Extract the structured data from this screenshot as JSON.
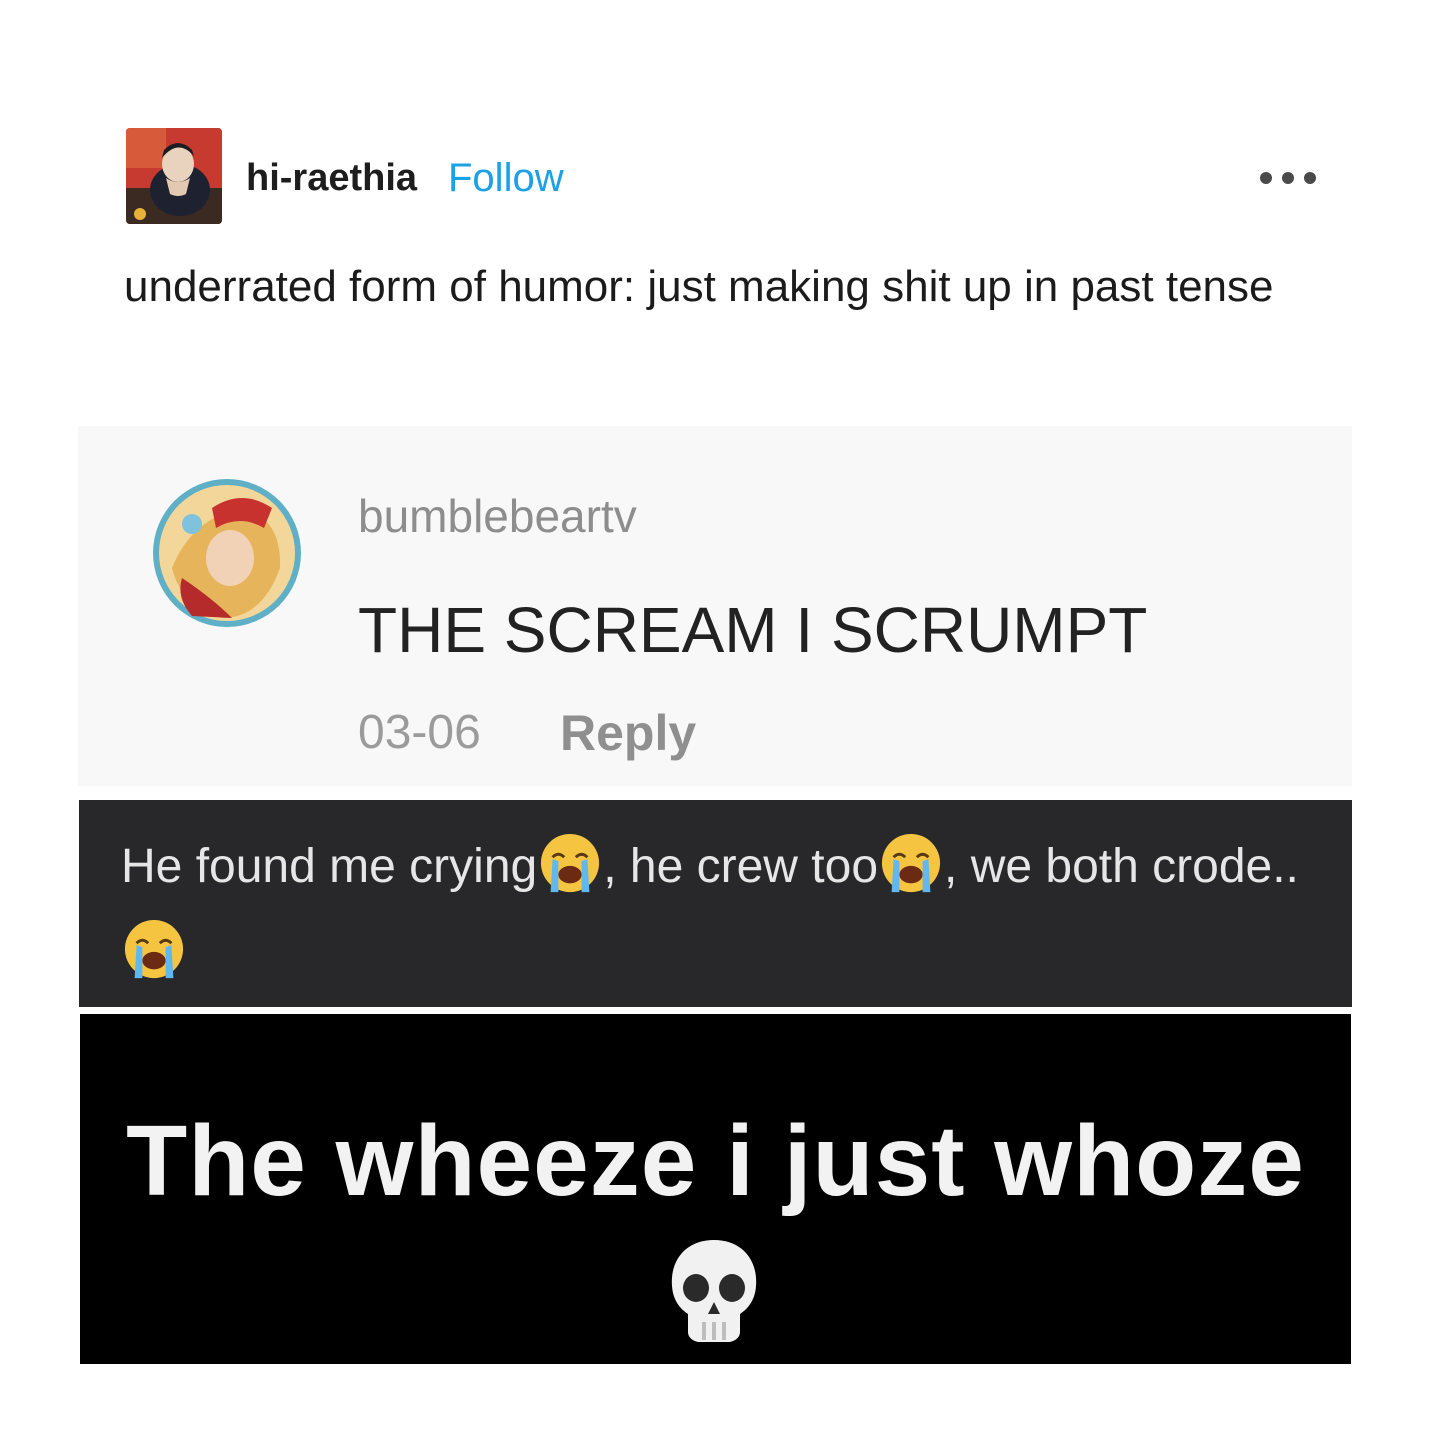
{
  "post": {
    "username": "hi-raethia",
    "follow_label": "Follow",
    "menu_icon": "more-horizontal-icon",
    "text": "underrated form of humor: just making shit up in past tense"
  },
  "comment_screenshot": {
    "username": "bumblebeartv",
    "text": "THE SCREAM I SCRUMPT",
    "date": "03-06",
    "reply_label": "Reply"
  },
  "dark_screenshot": {
    "part1": "He found me crying",
    "part2": ", he crew too",
    "part3": ", we both crode..",
    "emoji": "loudly-crying-face-icon"
  },
  "black_screenshot": {
    "text": "The wheeze i just whoze",
    "emoji": "skull-icon"
  }
}
